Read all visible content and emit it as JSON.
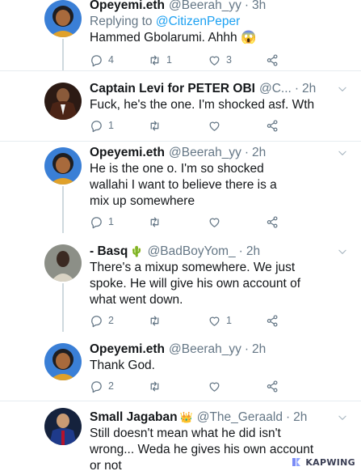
{
  "tweets": [
    {
      "name": "Opeyemi.eth",
      "handle": "@Beerah_yy",
      "sep": "·",
      "time": "3h",
      "replying_prefix": "Replying to",
      "replying_to": "@CitizenPeper",
      "text": "Hammed Gbolarumi. Ahhh 😱",
      "reply_count": "4",
      "retweet_count": "1",
      "like_count": "3"
    },
    {
      "name": "Captain Levi for PETER OBI",
      "handle": "@C...",
      "sep": "·",
      "time": "2h",
      "text": "Fuck, he's the one. I'm shocked asf. Wth",
      "reply_count": "1",
      "retweet_count": "",
      "like_count": ""
    },
    {
      "name": "Opeyemi.eth",
      "handle": "@Beerah_yy",
      "sep": "·",
      "time": "2h",
      "text": "He is the one o. I'm so shocked wallahi I want to believe there is a mix up somewhere",
      "reply_count": "1",
      "retweet_count": "",
      "like_count": ""
    },
    {
      "name": "- Basq",
      "badge": "🌵",
      "handle": "@BadBoyYom_",
      "sep": "·",
      "time": "2h",
      "text": "There's a mixup somewhere. We just spoke. He will give his own account of what went down.",
      "reply_count": "2",
      "retweet_count": "",
      "like_count": "1"
    },
    {
      "name": "Opeyemi.eth",
      "handle": "@Beerah_yy",
      "sep": "·",
      "time": "2h",
      "text": "Thank God.",
      "reply_count": "2",
      "retweet_count": "",
      "like_count": ""
    },
    {
      "name": "Small Jagaban",
      "badge": "👑",
      "handle": "@The_Geraald",
      "sep": "·",
      "time": "2h",
      "text": "Still doesn't mean what he did isn't wrong... Weda he gives his own account or not"
    }
  ],
  "watermark": {
    "label": "KAPWING"
  },
  "colors": {
    "text": "#14171a",
    "muted": "#657786",
    "link": "#1da1f2",
    "divider": "#e6ecf0",
    "thread_line": "#cfd9de"
  },
  "icons": [
    "reply-icon",
    "retweet-icon",
    "like-icon",
    "share-icon",
    "chevron-down-icon",
    "kapwing-logo"
  ]
}
